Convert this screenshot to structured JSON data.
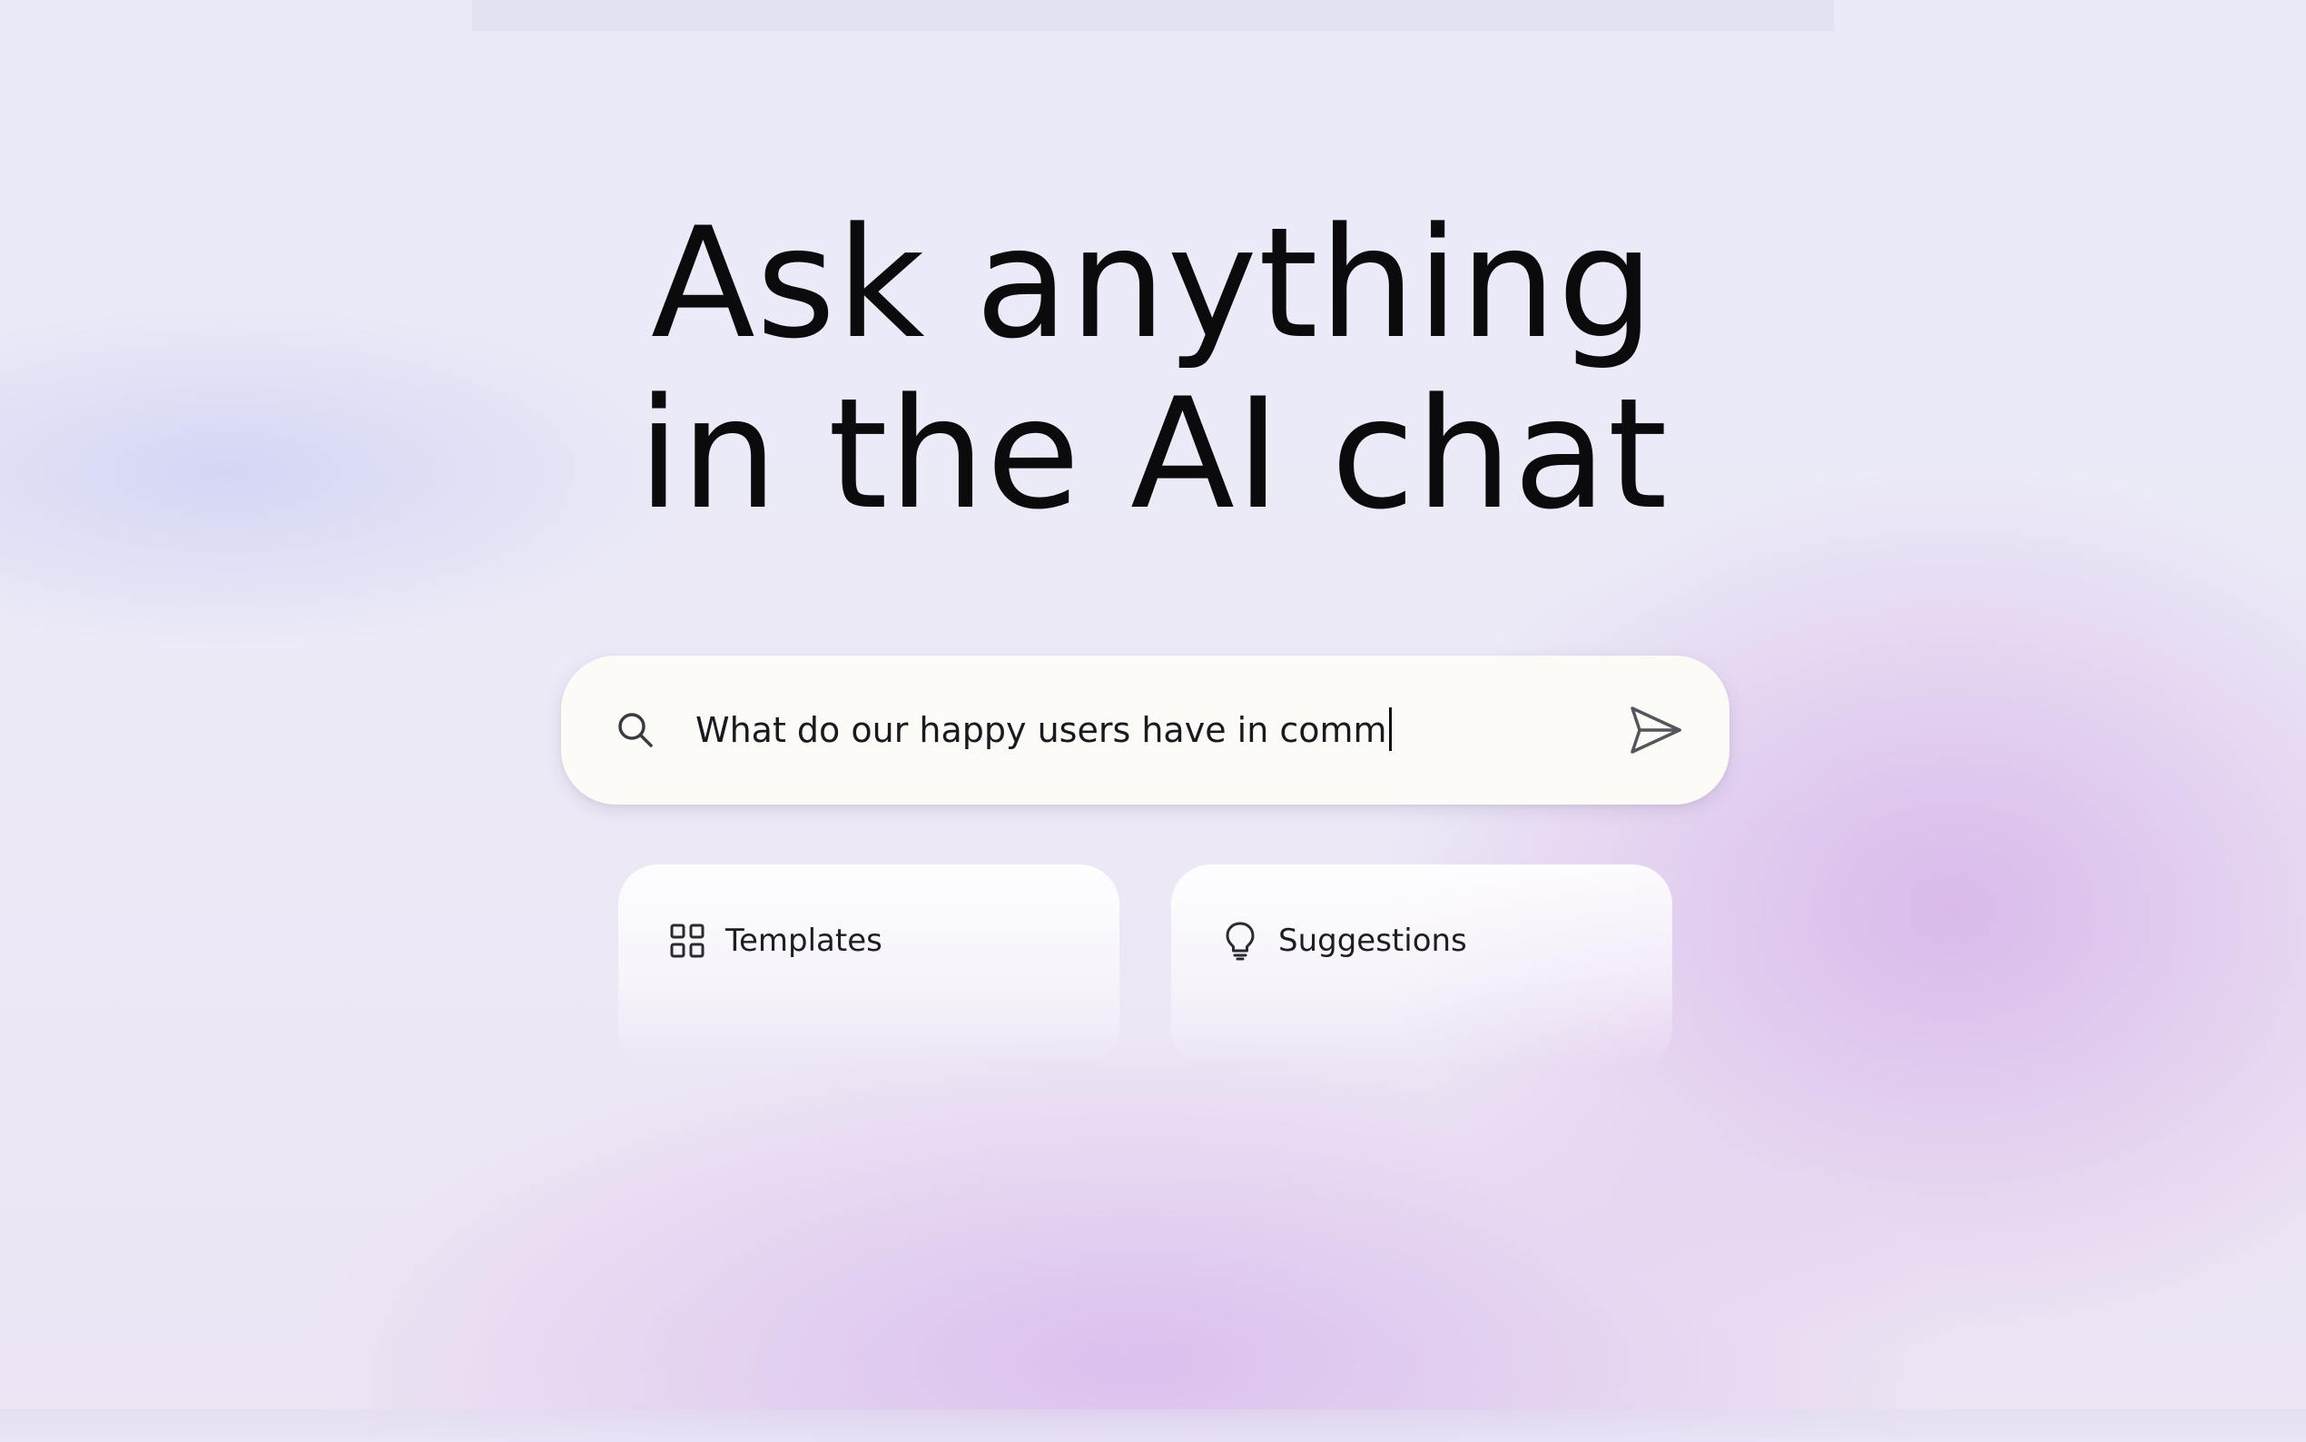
{
  "headline": {
    "line1": "Ask anything",
    "line2": "in the AI chat"
  },
  "search": {
    "value": "What do our happy users have in comm",
    "icon": "search-icon",
    "send_icon": "send-icon"
  },
  "cards": [
    {
      "label": "Templates",
      "icon": "grid-icon"
    },
    {
      "label": "Suggestions",
      "icon": "lightbulb-icon"
    }
  ],
  "colors": {
    "text": "#0b0b0d",
    "search_bg": "#fcfbf8",
    "accent_purple": "#d6b2e8",
    "background": "#e9ebf8"
  }
}
